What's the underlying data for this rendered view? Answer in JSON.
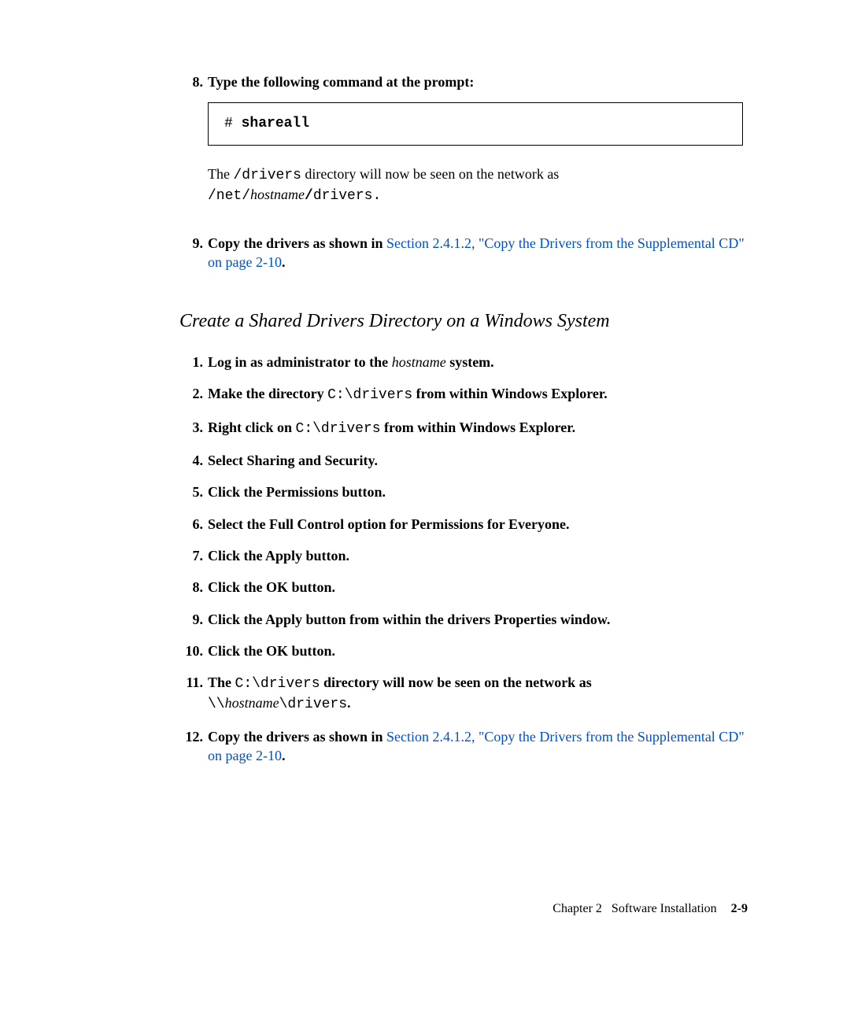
{
  "top": {
    "item8": {
      "num": "8.",
      "text": "Type the following command at the prompt:",
      "code_prompt": "# ",
      "code_cmd": "shareall",
      "after_a": "The ",
      "after_b": "/drivers",
      "after_c": " directory will now be seen on the network as ",
      "after_d": "/net/",
      "after_e": "hostname",
      "after_f": "/",
      "after_g": "drivers.",
      "copy_num": "9.",
      "copy_a": "Copy the drivers as shown in ",
      "copy_link": "Section 2.4.1.2, \"Copy the Drivers from the Supplemental CD\" on page 2-10",
      "copy_c": "."
    }
  },
  "section": {
    "title": "Create a Shared Drivers Directory on a Windows System",
    "steps": [
      {
        "num": "1.",
        "a": "Log in as administrator to the ",
        "b": "hostname",
        "c": " system."
      },
      {
        "num": "2.",
        "a": "Make the directory ",
        "b": "C:\\drivers",
        "c": " from within Windows Explorer."
      },
      {
        "num": "3.",
        "a": "Right click on ",
        "b": "C:\\drivers",
        "c": " from within Windows Explorer."
      },
      {
        "num": "4.",
        "a": "Select Sharing and Security."
      },
      {
        "num": "5.",
        "a": "Click the Permissions button."
      },
      {
        "num": "6.",
        "a": "Select the Full Control option for Permissions for Everyone."
      },
      {
        "num": "7.",
        "a": "Click the Apply button."
      },
      {
        "num": "8.",
        "a": "Click the OK button."
      },
      {
        "num": "9.",
        "a": "Click the Apply button from within the drivers Properties window."
      },
      {
        "num": "10.",
        "a": "Click the OK button."
      }
    ],
    "step11": {
      "num": "11.",
      "a": "The ",
      "b": "C:\\drivers",
      "c": " directory will now be seen on the network as ",
      "d": "\\\\",
      "e": "hostname",
      "f": "\\drivers",
      "g": "."
    },
    "step12": {
      "num": "12.",
      "a": "Copy the drivers as shown in ",
      "link": "Section 2.4.1.2, \"Copy the Drivers from the Supplemental CD\" on page 2-10",
      "c": "."
    }
  },
  "footer": {
    "chapter": "Chapter 2",
    "title": "Software Installation",
    "page": "2-9"
  }
}
